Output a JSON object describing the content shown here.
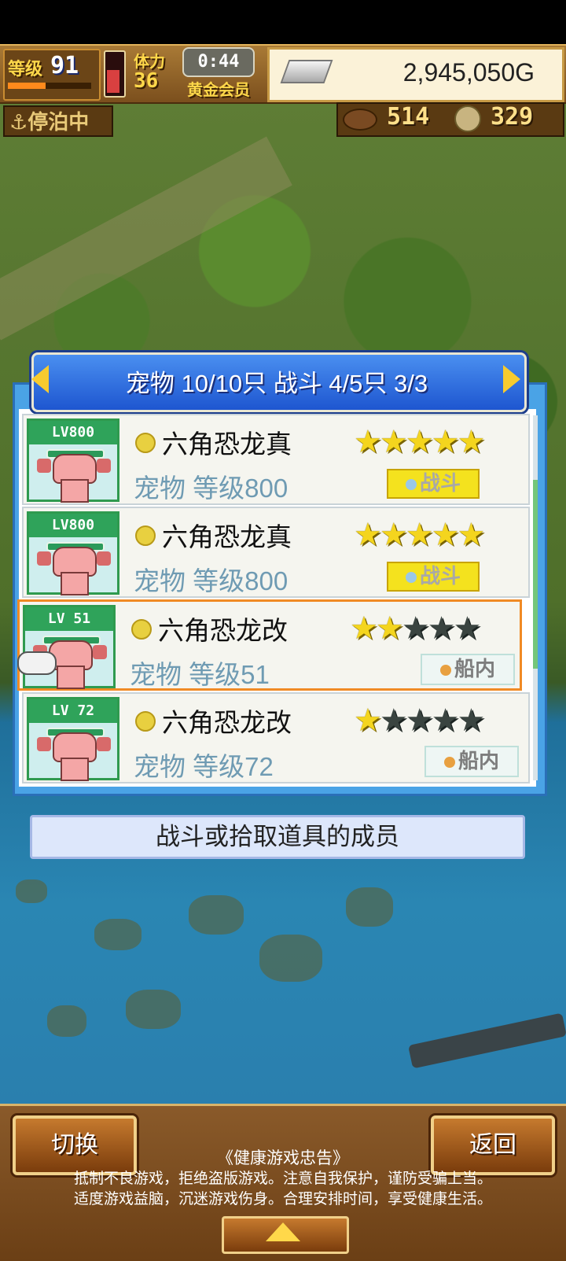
{
  "status": {
    "level_label": "等级",
    "level": "91",
    "level_progress": 0.45,
    "hp_fill": 0.55,
    "stamina_label": "体力",
    "stamina": "36",
    "timer": "0:44",
    "membership": "黄金会员",
    "gold": "2,945,050G",
    "docked": "⚓停泊中",
    "food": "514",
    "coins": "329"
  },
  "dialog": {
    "title": "宠物 10/10只 战斗 4/5只  3/3",
    "caption": "战斗或拾取道具的成员"
  },
  "pets": [
    {
      "lv": "LV800",
      "name": "六角恐龙真",
      "sub": "宠物 等级800",
      "stars_on": "★★★★★",
      "stars_off": "",
      "badge": "战斗",
      "badge_type": "battle"
    },
    {
      "lv": "LV800",
      "name": "六角恐龙真",
      "sub": "宠物 等级800",
      "stars_on": "★★★★★",
      "stars_off": "",
      "badge": "战斗",
      "badge_type": "battle"
    },
    {
      "lv": "LV 51",
      "name": "六角恐龙改",
      "sub": "宠物 等级51",
      "stars_on": "★★",
      "stars_off": "★★★",
      "badge": "船内",
      "badge_type": "ship"
    },
    {
      "lv": "LV 72",
      "name": "六角恐龙改",
      "sub": "宠物 等级72",
      "stars_on": "★",
      "stars_off": "★★★★",
      "badge": "船内",
      "badge_type": "ship"
    }
  ],
  "buttons": {
    "switch": "切换",
    "back": "返回"
  },
  "notice": {
    "title": "《健康游戏忠告》",
    "line1": "抵制不良游戏，拒绝盗版游戏。注意自我保护，谨防受骗上当。",
    "line2": "适度游戏益脑，沉迷游戏伤身。合理安排时间，享受健康生活。"
  },
  "icons": {
    "arrow_left": "chevron-left-icon",
    "arrow_right": "chevron-right-icon",
    "up": "up-arrow-icon",
    "pointer": "hand-pointer-icon"
  }
}
